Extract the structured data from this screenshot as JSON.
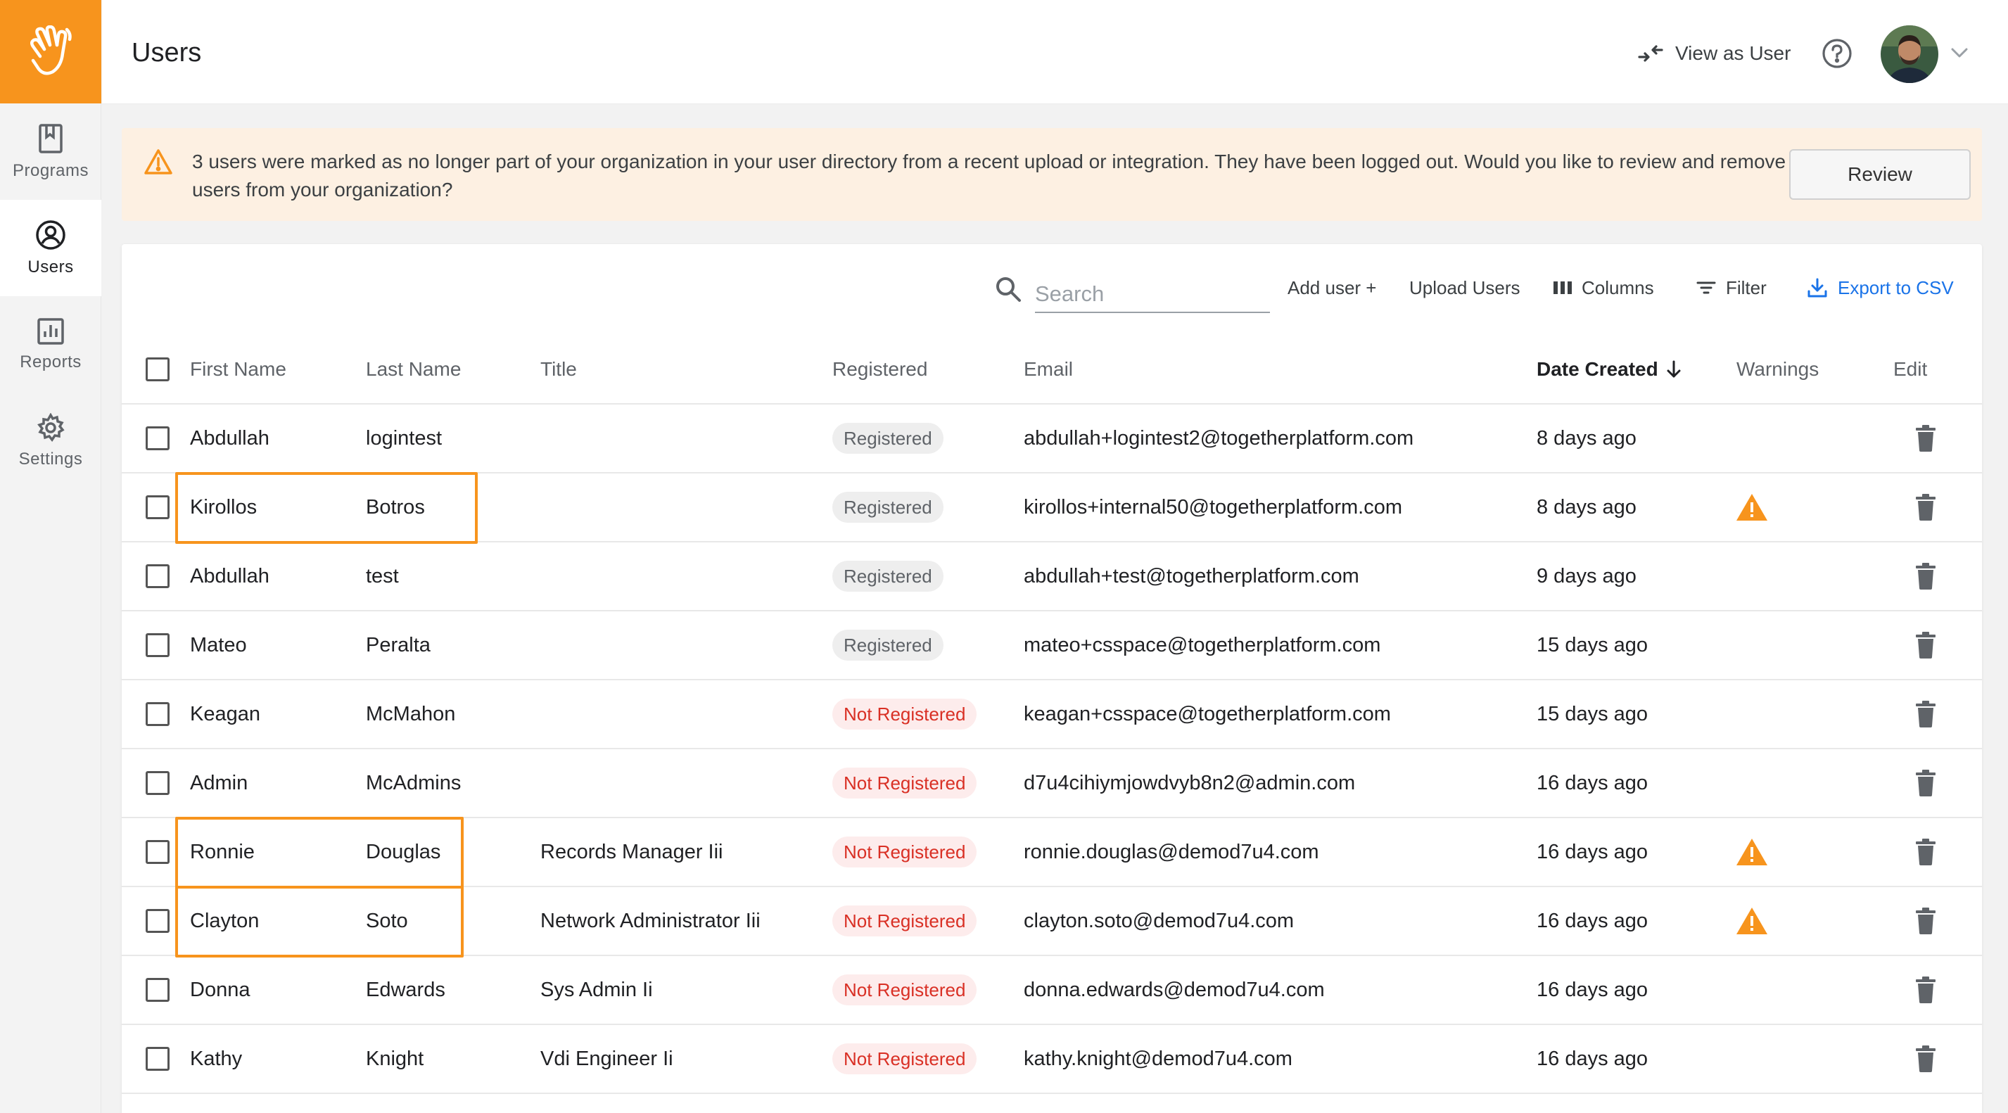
{
  "sidebar": {
    "items": [
      {
        "label": "Programs",
        "icon": "bookmark-icon"
      },
      {
        "label": "Users",
        "icon": "user-circle-icon",
        "active": true
      },
      {
        "label": "Reports",
        "icon": "bar-chart-icon"
      },
      {
        "label": "Settings",
        "icon": "gear-icon"
      }
    ],
    "logo_icon": "waving-hand-icon",
    "logo_color": "#f7941d"
  },
  "header": {
    "title": "Users",
    "view_as_user_label": "View as User",
    "help_icon": "help-circle-icon"
  },
  "alert": {
    "message": "3 users were marked as no longer part of your organization in your user directory from a recent upload or integration. They have been logged out. Would you like to review and remove these users from your organization?",
    "review_label": "Review",
    "icon": "warning-triangle-icon"
  },
  "toolbar": {
    "search_placeholder": "Search",
    "add_user_label": "Add user +",
    "upload_users_label": "Upload Users",
    "columns_label": "Columns",
    "filter_label": "Filter",
    "export_label": "Export to CSV"
  },
  "table": {
    "columns": {
      "first_name": "First Name",
      "last_name": "Last Name",
      "title": "Title",
      "registered": "Registered",
      "email": "Email",
      "date_created": "Date Created",
      "warnings": "Warnings",
      "edit": "Edit"
    },
    "sort": {
      "column": "date_created",
      "direction": "descending"
    },
    "rows": [
      {
        "first": "Abdullah",
        "last": "logintest",
        "title": "",
        "status": "Registered",
        "email": "abdullah+logintest2@togetherplatform.com",
        "date": "8 days ago",
        "warning": false,
        "highlight": false
      },
      {
        "first": "Kirollos",
        "last": "Botros",
        "title": "",
        "status": "Registered",
        "email": "kirollos+internal50@togetherplatform.com",
        "date": "8 days ago",
        "warning": true,
        "highlight": true
      },
      {
        "first": "Abdullah",
        "last": "test",
        "title": "",
        "status": "Registered",
        "email": "abdullah+test@togetherplatform.com",
        "date": "9 days ago",
        "warning": false,
        "highlight": false
      },
      {
        "first": "Mateo",
        "last": "Peralta",
        "title": "",
        "status": "Registered",
        "email": "mateo+csspace@togetherplatform.com",
        "date": "15 days ago",
        "warning": false,
        "highlight": false
      },
      {
        "first": "Keagan",
        "last": "McMahon",
        "title": "",
        "status": "Not Registered",
        "email": "keagan+csspace@togetherplatform.com",
        "date": "15 days ago",
        "warning": false,
        "highlight": false
      },
      {
        "first": "Admin",
        "last": "McAdmins",
        "title": "",
        "status": "Not Registered",
        "email": "d7u4cihiymjowdvyb8n2@admin.com",
        "date": "16 days ago",
        "warning": false,
        "highlight": false
      },
      {
        "first": "Ronnie",
        "last": "Douglas",
        "title": "Records Manager Iii",
        "status": "Not Registered",
        "email": "ronnie.douglas@demod7u4.com",
        "date": "16 days ago",
        "warning": true,
        "highlight": true
      },
      {
        "first": "Clayton",
        "last": "Soto",
        "title": "Network Administrator Iii",
        "status": "Not Registered",
        "email": "clayton.soto@demod7u4.com",
        "date": "16 days ago",
        "warning": true,
        "highlight": true
      },
      {
        "first": "Donna",
        "last": "Edwards",
        "title": "Sys Admin Ii",
        "status": "Not Registered",
        "email": "donna.edwards@demod7u4.com",
        "date": "16 days ago",
        "warning": false,
        "highlight": false
      },
      {
        "first": "Kathy",
        "last": "Knight",
        "title": "Vdi Engineer Ii",
        "status": "Not Registered",
        "email": "kathy.knight@demod7u4.com",
        "date": "16 days ago",
        "warning": false,
        "highlight": false
      }
    ]
  },
  "colors": {
    "accent": "#f7941d",
    "warning": "#f7941d",
    "link": "#1a73e8",
    "not_registered": "#d93025"
  }
}
